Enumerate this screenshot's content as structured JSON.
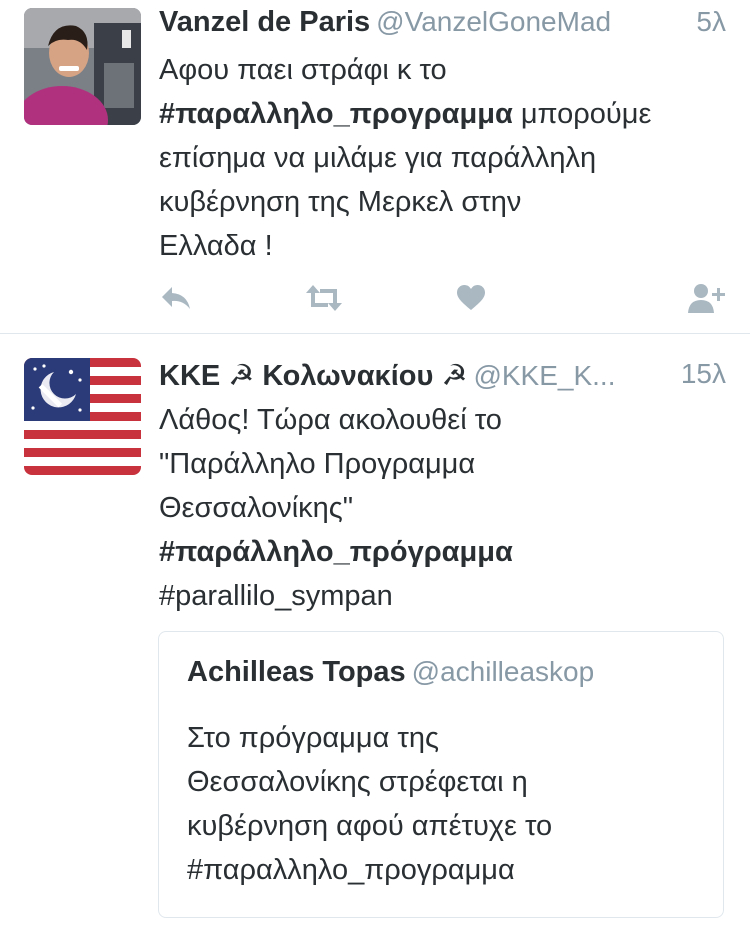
{
  "tweets": [
    {
      "name": "Vanzel de Paris",
      "handle": "@VanzelGoneMad",
      "time": "5λ",
      "lines": [
        [
          {
            "t": "Αφου παει στράφι κ το",
            "b": false
          }
        ],
        [
          {
            "t": "#παραλληλο_προγραμμα",
            "b": true
          },
          {
            "t": " μπορούμε",
            "b": false
          }
        ],
        [
          {
            "t": "επίσημα να μιλάμε για παράλληλη",
            "b": false
          }
        ],
        [
          {
            "t": "κυβέρνηση της Μερκελ στην",
            "b": false
          }
        ],
        [
          {
            "t": "Ελλαδα !",
            "b": false
          }
        ]
      ],
      "actions": [
        "reply-icon",
        "retweet-icon",
        "heart-icon",
        "follow-icon"
      ]
    },
    {
      "name": "ΚΚΕ ☭ Κολωνακίου ☭",
      "handle": "@KKE_K...",
      "time": "15λ",
      "lines": [
        [
          {
            "t": "Λάθος! Τώρα ακολουθεί το",
            "b": false
          }
        ],
        [
          {
            "t": "\"Παράλληλο Προγραμμα",
            "b": false
          }
        ],
        [
          {
            "t": "Θεσσαλονίκης\"",
            "b": false
          }
        ],
        [
          {
            "t": "#παράλληλο_πρόγραμμα",
            "b": true
          }
        ],
        [
          {
            "t": "#parallilo_sympan",
            "b": false
          }
        ]
      ]
    }
  ],
  "quote": {
    "name": "Achilleas Topas",
    "handle": "@achilleaskop",
    "lines": [
      "Στο πρόγραμμα της",
      "Θεσσαλονίκης στρέφεται η",
      "κυβέρνηση αφού απέτυχε το",
      "#παραλληλο_προγραμμα"
    ]
  },
  "colors": {
    "text": "#292f33",
    "muted": "#8899a6",
    "icon": "#aab8c2",
    "divider": "#e1e8ed"
  }
}
